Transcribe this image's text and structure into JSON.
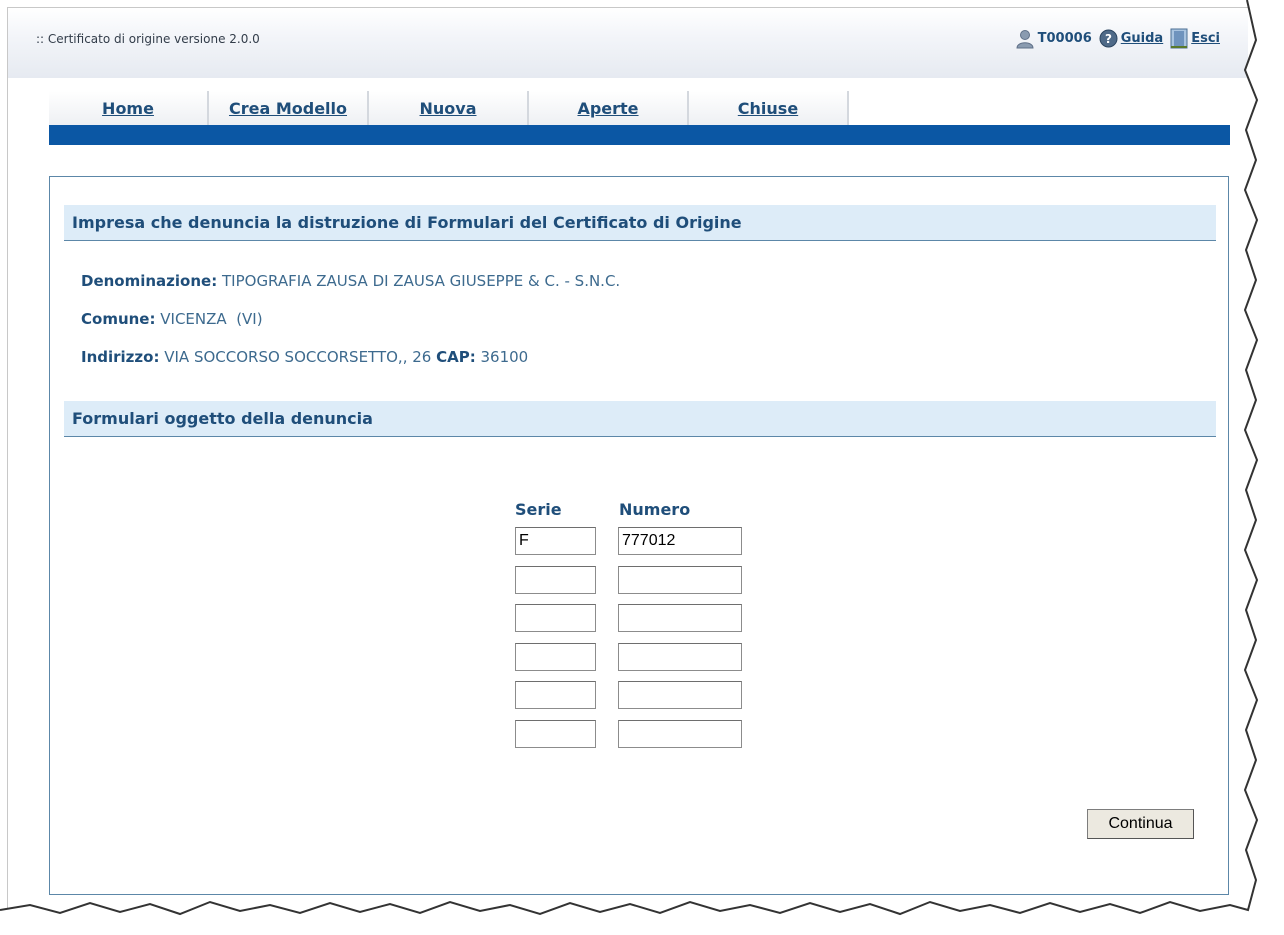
{
  "app": {
    "title": ":: Certificato di origine versione 2.0.0",
    "user": "T00006",
    "help_label": "Guida",
    "exit_label": "Esci"
  },
  "nav": {
    "tabs": [
      "Home",
      "Crea Modello",
      "Nuova",
      "Aperte",
      "Chiuse"
    ]
  },
  "company_section": {
    "title": "Impresa che denuncia la distruzione di Formulari del Certificato di Origine",
    "denominazione_label": "Denominazione:",
    "denominazione_value": "TIPOGRAFIA ZAUSA DI ZAUSA GIUSEPPE & C. - S.N.C.",
    "comune_label": "Comune:",
    "comune_value": "VICENZA  (VI)",
    "indirizzo_label": "Indirizzo:",
    "indirizzo_value": "VIA SOCCORSO SOCCORSETTO,, 26",
    "cap_label": "CAP:",
    "cap_value": "36100"
  },
  "forms_section": {
    "title": "Formulari oggetto della denuncia",
    "serie_header": "Serie",
    "numero_header": "Numero",
    "rows": [
      {
        "serie": "F",
        "numero": "777012"
      },
      {
        "serie": "",
        "numero": ""
      },
      {
        "serie": "",
        "numero": ""
      },
      {
        "serie": "",
        "numero": ""
      },
      {
        "serie": "",
        "numero": ""
      },
      {
        "serie": "",
        "numero": ""
      }
    ]
  },
  "actions": {
    "continue_label": "Continua"
  },
  "icons": {
    "user": "user-icon",
    "help": "help-icon",
    "exit": "exit-door-icon"
  },
  "colors": {
    "nav_bar": "#0b57a4",
    "section_header_bg": "#ddecf8",
    "heading_text": "#1f4e7a"
  }
}
